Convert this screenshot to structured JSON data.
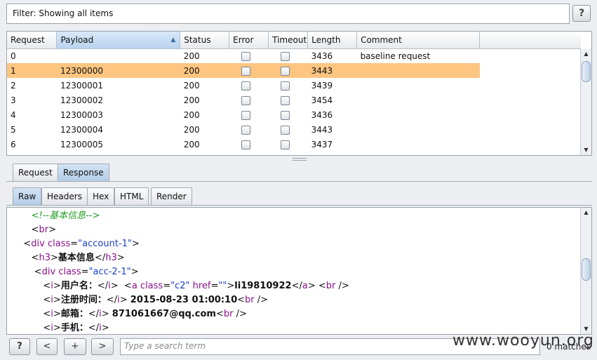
{
  "filter": {
    "text": "Filter: Showing all items",
    "help": "?"
  },
  "table": {
    "columns": [
      "Request",
      "Payload",
      "Status",
      "Error",
      "Timeout",
      "Length",
      "Comment"
    ],
    "sort_arrow": "▲",
    "selected_index": 1,
    "rows": [
      {
        "request": "0",
        "payload": "",
        "status": "200",
        "length": "3436",
        "comment": "baseline request"
      },
      {
        "request": "1",
        "payload": "12300000",
        "status": "200",
        "length": "3443",
        "comment": ""
      },
      {
        "request": "2",
        "payload": "12300001",
        "status": "200",
        "length": "3439",
        "comment": ""
      },
      {
        "request": "3",
        "payload": "12300002",
        "status": "200",
        "length": "3454",
        "comment": ""
      },
      {
        "request": "4",
        "payload": "12300003",
        "status": "200",
        "length": "3436",
        "comment": ""
      },
      {
        "request": "5",
        "payload": "12300004",
        "status": "200",
        "length": "3443",
        "comment": ""
      },
      {
        "request": "6",
        "payload": "12300005",
        "status": "200",
        "length": "3437",
        "comment": ""
      }
    ]
  },
  "tabs_top": [
    "Request",
    "Response"
  ],
  "tabs_view": [
    "Raw",
    "Headers",
    "Hex",
    "HTML",
    "Render"
  ],
  "code_lines": [
    {
      "indent": 6,
      "tokens": [
        {
          "c": "t-comment",
          "t": "<!--基本信息-->"
        }
      ]
    },
    {
      "indent": 6,
      "tokens": [
        {
          "c": "t-plain",
          "t": "<"
        },
        {
          "c": "t-tag",
          "t": "br"
        },
        {
          "c": "t-plain",
          "t": ">"
        }
      ]
    },
    {
      "indent": 4,
      "tokens": [
        {
          "c": "t-plain",
          "t": "<"
        },
        {
          "c": "t-tag",
          "t": "div"
        },
        {
          "c": "t-attr",
          "t": " class"
        },
        {
          "c": "t-plain",
          "t": "="
        },
        {
          "c": "t-val",
          "t": "\"account-1\""
        },
        {
          "c": "t-plain",
          "t": ">"
        }
      ]
    },
    {
      "indent": 6,
      "tokens": [
        {
          "c": "t-plain",
          "t": "<"
        },
        {
          "c": "t-tag",
          "t": "h3"
        },
        {
          "c": "t-plain",
          "t": ">"
        },
        {
          "c": "t-text",
          "t": "基本信息"
        },
        {
          "c": "t-plain",
          "t": "</"
        },
        {
          "c": "t-tag",
          "t": "h3"
        },
        {
          "c": "t-plain",
          "t": ">"
        }
      ]
    },
    {
      "indent": 6,
      "tokens": [
        {
          "c": "t-plain",
          "t": " <"
        },
        {
          "c": "t-tag",
          "t": "div"
        },
        {
          "c": "t-attr",
          "t": " class"
        },
        {
          "c": "t-plain",
          "t": "="
        },
        {
          "c": "t-val",
          "t": "\"acc-2-1\""
        },
        {
          "c": "t-plain",
          "t": ">"
        }
      ]
    },
    {
      "indent": 9,
      "tokens": [
        {
          "c": "t-plain",
          "t": "<"
        },
        {
          "c": "t-tag",
          "t": "i"
        },
        {
          "c": "t-plain",
          "t": ">"
        },
        {
          "c": "t-text",
          "t": "用户名："
        },
        {
          "c": "t-plain",
          "t": "</"
        },
        {
          "c": "t-tag",
          "t": "i"
        },
        {
          "c": "t-plain",
          "t": ">  <"
        },
        {
          "c": "t-tag",
          "t": "a"
        },
        {
          "c": "t-attr",
          "t": " class"
        },
        {
          "c": "t-plain",
          "t": "="
        },
        {
          "c": "t-val",
          "t": "\"c2\""
        },
        {
          "c": "t-attr",
          "t": " href"
        },
        {
          "c": "t-plain",
          "t": "="
        },
        {
          "c": "t-val",
          "t": "\"\""
        },
        {
          "c": "t-plain",
          "t": ">"
        },
        {
          "c": "t-text",
          "t": "li19810922"
        },
        {
          "c": "t-plain",
          "t": "</"
        },
        {
          "c": "t-tag",
          "t": "a"
        },
        {
          "c": "t-plain",
          "t": "> <"
        },
        {
          "c": "t-tag",
          "t": "br"
        },
        {
          "c": "t-plain",
          "t": " />"
        }
      ]
    },
    {
      "indent": 9,
      "tokens": [
        {
          "c": "t-plain",
          "t": "<"
        },
        {
          "c": "t-tag",
          "t": "i"
        },
        {
          "c": "t-plain",
          "t": ">"
        },
        {
          "c": "t-text",
          "t": "注册时间："
        },
        {
          "c": "t-plain",
          "t": "</"
        },
        {
          "c": "t-tag",
          "t": "i"
        },
        {
          "c": "t-plain",
          "t": "> "
        },
        {
          "c": "t-text",
          "t": "2015-08-23 01:00:10"
        },
        {
          "c": "t-plain",
          "t": "<"
        },
        {
          "c": "t-tag",
          "t": "br"
        },
        {
          "c": "t-plain",
          "t": " />"
        }
      ]
    },
    {
      "indent": 9,
      "tokens": [
        {
          "c": "t-plain",
          "t": "<"
        },
        {
          "c": "t-tag",
          "t": "i"
        },
        {
          "c": "t-plain",
          "t": ">"
        },
        {
          "c": "t-text",
          "t": "邮箱："
        },
        {
          "c": "t-plain",
          "t": "</"
        },
        {
          "c": "t-tag",
          "t": "i"
        },
        {
          "c": "t-plain",
          "t": "> "
        },
        {
          "c": "t-text",
          "t": "871061667@qq.com"
        },
        {
          "c": "t-plain",
          "t": "<"
        },
        {
          "c": "t-tag",
          "t": "br"
        },
        {
          "c": "t-plain",
          "t": " />"
        }
      ]
    },
    {
      "indent": 9,
      "tokens": [
        {
          "c": "t-plain",
          "t": "<"
        },
        {
          "c": "t-tag",
          "t": "i"
        },
        {
          "c": "t-plain",
          "t": ">"
        },
        {
          "c": "t-text",
          "t": "手机："
        },
        {
          "c": "t-plain",
          "t": "</"
        },
        {
          "c": "t-tag",
          "t": "i"
        },
        {
          "c": "t-plain",
          "t": ">"
        }
      ]
    }
  ],
  "bottom": {
    "help": "?",
    "prev": "<",
    "add": "+",
    "next": ">",
    "search_placeholder": "Type a search term",
    "matches": "0 matches"
  },
  "watermark": "www.wooyun.org",
  "colors": {
    "selected_row": "#fcc580",
    "active_tab": "#b3cde8"
  }
}
